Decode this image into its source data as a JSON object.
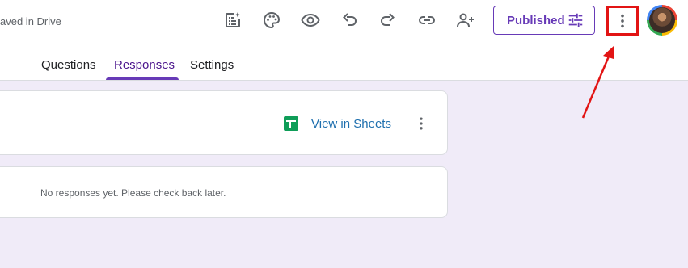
{
  "header": {
    "saved_status": "aved in Drive",
    "publish_label": "Published",
    "toolbar_icons": [
      "customize-theme-icon",
      "palette-icon",
      "preview-icon",
      "undo-icon",
      "redo-icon",
      "link-icon",
      "add-collaborator-icon",
      "tune-icon",
      "more-vert-icon",
      "avatar"
    ]
  },
  "tabs": [
    {
      "label": "Questions",
      "active": false
    },
    {
      "label": "Responses",
      "active": true
    },
    {
      "label": "Settings",
      "active": false
    }
  ],
  "responses": {
    "view_in_sheets_label": "View in Sheets",
    "empty_message": "No responses yet. Please check back later."
  },
  "colors": {
    "accent": "#673ab7",
    "background": "#f0ebf8",
    "sheets_green": "#0f9d58",
    "highlight_red": "#e21414"
  }
}
